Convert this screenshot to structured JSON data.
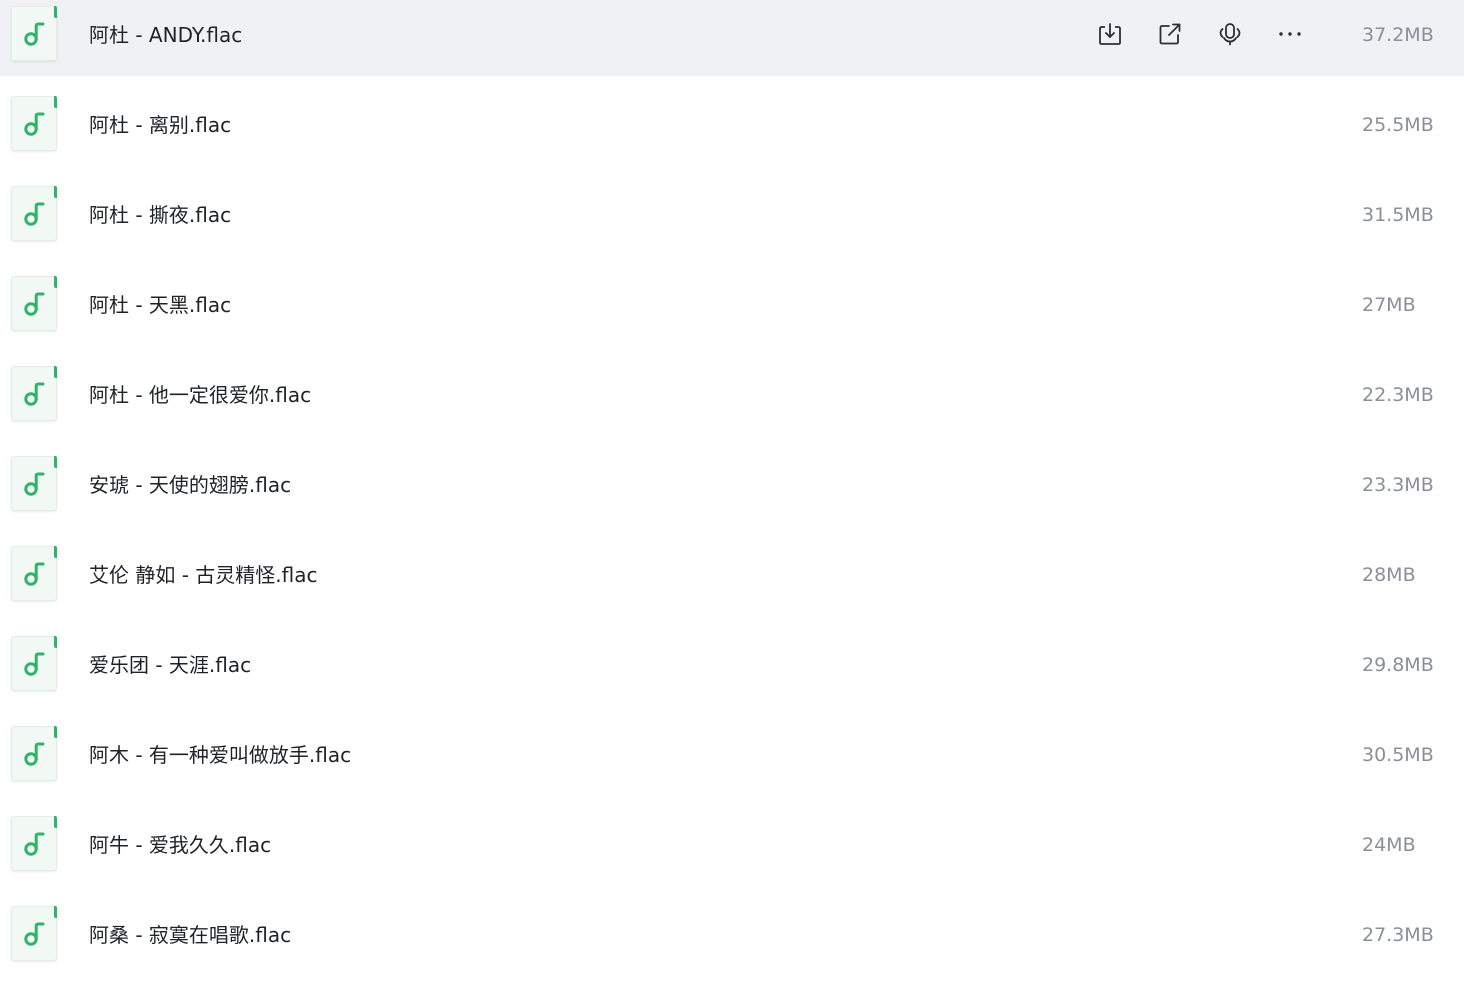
{
  "files": [
    {
      "name": "阿杜 - ANDY.flac",
      "size": "37.2MB",
      "active": true
    },
    {
      "name": "阿杜 - 离别.flac",
      "size": "25.5MB"
    },
    {
      "name": "阿杜 - 撕夜.flac",
      "size": "31.5MB"
    },
    {
      "name": "阿杜 - 天黑.flac",
      "size": "27MB"
    },
    {
      "name": "阿杜 - 他一定很爱你.flac",
      "size": "22.3MB"
    },
    {
      "name": "安琥 - 天使的翅膀.flac",
      "size": "23.3MB"
    },
    {
      "name": "艾伦 静如 - 古灵精怪.flac",
      "size": "28MB"
    },
    {
      "name": "爱乐团 - 天涯.flac",
      "size": "29.8MB"
    },
    {
      "name": "阿木 - 有一种爱叫做放手.flac",
      "size": "30.5MB"
    },
    {
      "name": "阿牛 - 爱我久久.flac",
      "size": "24MB"
    },
    {
      "name": "阿桑 - 寂寞在唱歌.flac",
      "size": "27.3MB"
    }
  ],
  "row_actions": [
    {
      "id": "download",
      "icon": "download-icon"
    },
    {
      "id": "share",
      "icon": "share-icon"
    },
    {
      "id": "audio",
      "icon": "audio-play-icon"
    },
    {
      "id": "more",
      "icon": "more-icon"
    }
  ],
  "colors": {
    "accent": "#2fb36b",
    "row_hover": "#f0f1f4",
    "size_text": "#8a8f99"
  }
}
